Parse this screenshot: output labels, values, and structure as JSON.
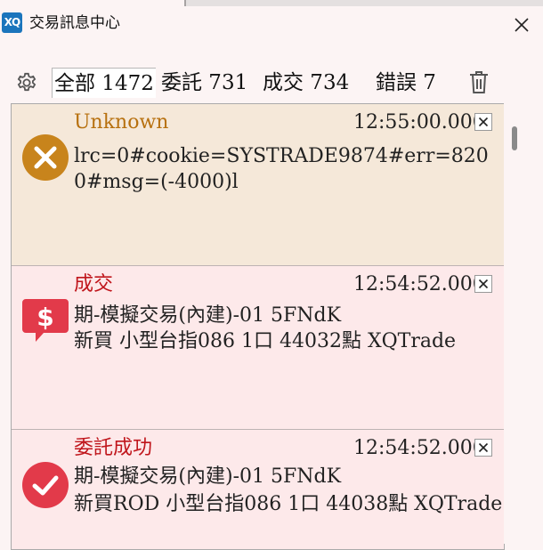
{
  "window": {
    "logo_text": "XQ",
    "title": "交易訊息中心"
  },
  "toolbar": {
    "tabs": [
      {
        "label": "全部 1472",
        "active": true
      },
      {
        "label": "委託 731",
        "active": false
      },
      {
        "label": "成交 734",
        "active": false
      },
      {
        "label": "錯誤 7",
        "active": false
      }
    ]
  },
  "messages": [
    {
      "kind": "Unknown",
      "time": "12:55:00.000",
      "icon": "error-x-icon",
      "lines": [
        "lrc=0#cookie=SYSTRADE9874#err=8200#msg=(-4000)l"
      ]
    },
    {
      "kind": "成交",
      "time": "12:54:52.000",
      "icon": "dollar-chat-icon",
      "lines": [
        "期-模擬交易(內建)-01 5FNdK",
        "新買 小型台指086 1口 44032點 XQTrade"
      ]
    },
    {
      "kind": "委託成功",
      "time": "12:54:52.000",
      "icon": "check-circle-icon",
      "lines": [
        "期-模擬交易(內建)-01 5FNdK",
        "新買ROD 小型台指086 1口 44038點 XQTrade"
      ]
    }
  ],
  "colors": {
    "window_bg": "#fcf4f4",
    "unknown_bg": "#f5e8d9",
    "trade_bg": "#fde9ea",
    "unknown_text": "#b7700f",
    "trade_text": "#c0161c",
    "error_icon": "#c8841c",
    "trade_icon": "#e23a4a",
    "logo": "#1b75bc"
  }
}
